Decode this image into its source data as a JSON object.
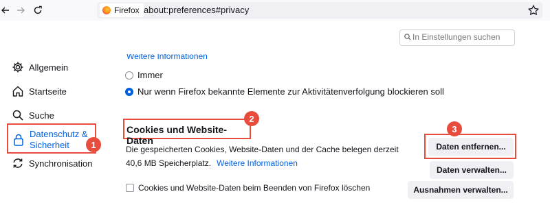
{
  "browser": {
    "identity_label": "Firefox",
    "url": "about:preferences#privacy"
  },
  "search": {
    "placeholder": "In Einstellungen suchen"
  },
  "sidebar": {
    "items": [
      {
        "label": "Allgemein",
        "icon": "gear-icon"
      },
      {
        "label": "Startseite",
        "icon": "home-icon"
      },
      {
        "label": "Suche",
        "icon": "search-icon"
      },
      {
        "label": "Datenschutz & Sicherheit",
        "label_line1": "Datenschutz &",
        "label_line2": "Sicherheit",
        "icon": "lock-icon",
        "active": true
      },
      {
        "label": "Synchronisation",
        "icon": "sync-icon"
      }
    ]
  },
  "tracking": {
    "cut_link": "Weitere Informationen",
    "options": [
      {
        "label": "Immer",
        "checked": false
      },
      {
        "label": "Nur wenn Firefox bekannte Elemente zur Aktivitätenverfolgung blockieren soll",
        "checked": true
      }
    ]
  },
  "cookies": {
    "title": "Cookies und Website-Daten",
    "description_line1": "Die gespeicherten Cookies, Website-Daten und der Cache belegen derzeit",
    "description_line2": "40,6 MB Speicherplatz.",
    "learn_more": "Weitere Informationen",
    "buttons": {
      "clear": "Daten entfernen...",
      "manage": "Daten verwalten...",
      "exceptions": "Ausnahmen verwalten..."
    },
    "delete_on_close": "Cookies und Website-Daten beim Beenden von Firefox löschen"
  },
  "annotations": {
    "badge1": "1",
    "badge2": "2",
    "badge3": "3",
    "color": "#e74c3c"
  },
  "colors": {
    "accent": "#0061e0",
    "text": "#15141a",
    "toolbar": "#f9f9fb"
  }
}
